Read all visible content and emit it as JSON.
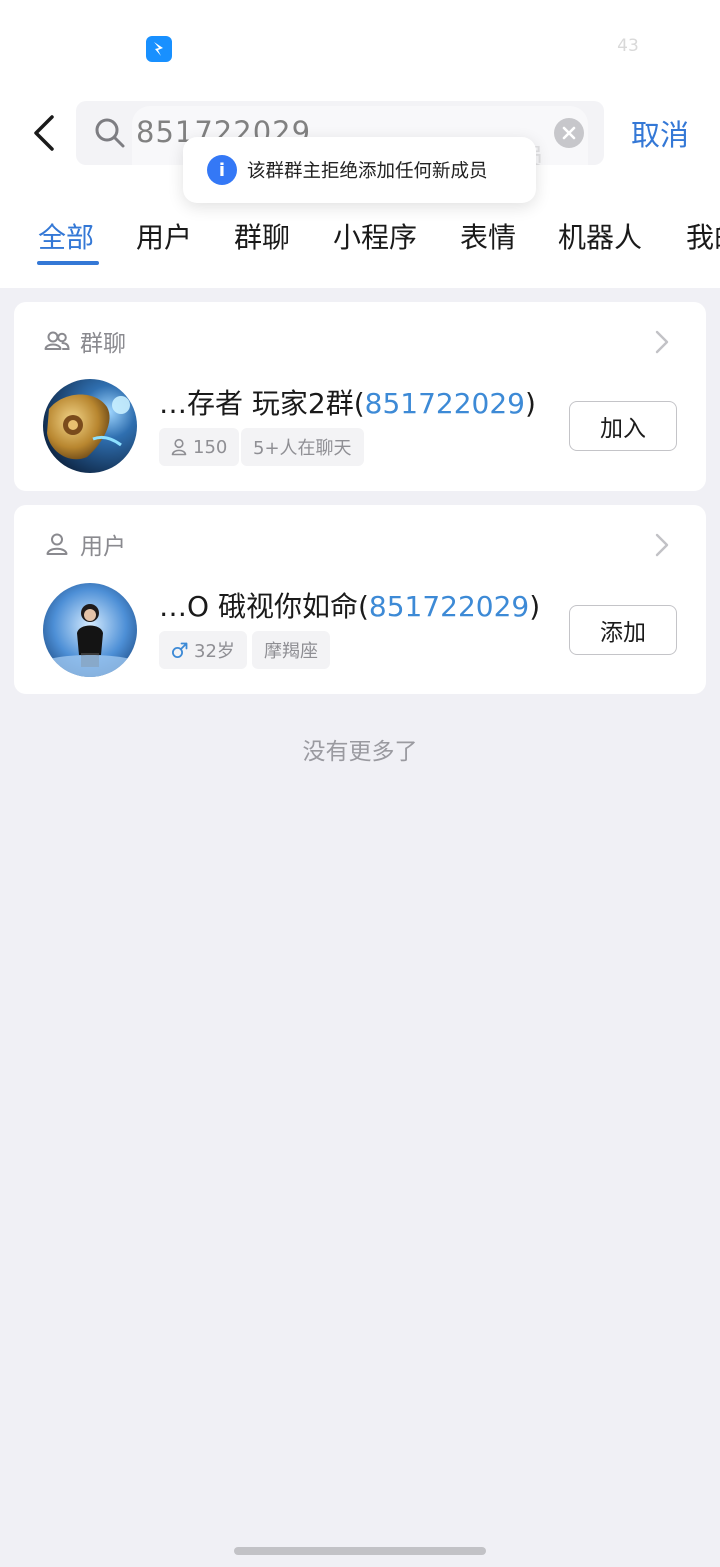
{
  "status": {
    "number": "43"
  },
  "search": {
    "query": "851722029",
    "ghost_hint": "员",
    "cancel_label": "取消"
  },
  "toast": {
    "message": "该群群主拒绝添加任何新成员"
  },
  "tabs": [
    {
      "label": "全部",
      "active": true
    },
    {
      "label": "用户"
    },
    {
      "label": "群聊"
    },
    {
      "label": "小程序"
    },
    {
      "label": "表情"
    },
    {
      "label": "机器人"
    },
    {
      "label": "我的"
    }
  ],
  "group_section": {
    "header": "群聊",
    "item": {
      "title_prefix": "…存者 玩家2群(",
      "title_highlight": "851722029",
      "title_suffix": ")",
      "tags": [
        "150",
        "5+人在聊天"
      ],
      "action": "加入"
    }
  },
  "user_section": {
    "header": "用户",
    "item": {
      "title_prefix": "…O 硪视你如命(",
      "title_highlight": "851722029",
      "title_suffix": ")",
      "tags": [
        "32岁",
        "摩羯座"
      ],
      "action": "添加"
    }
  },
  "footer": {
    "no_more": "没有更多了"
  },
  "colors": {
    "accent": "#3478d6",
    "highlight": "#3d8ad6",
    "toast_icon": "#3478f6",
    "background": "#f0f0f5"
  }
}
